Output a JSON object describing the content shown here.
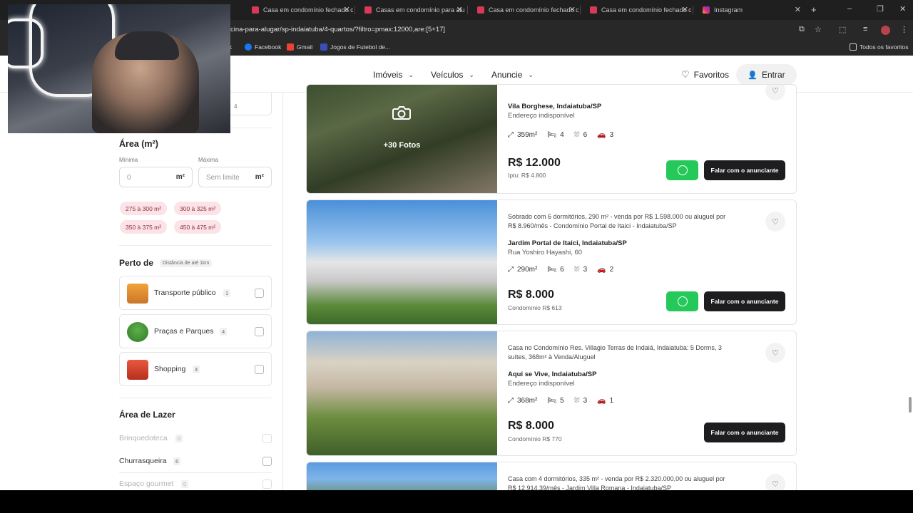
{
  "browser": {
    "tabs": [
      {
        "label": "Casa em condomínio fechado c"
      },
      {
        "label": "Casas em condomínio para alu"
      },
      {
        "label": "Casa em condomínio fechado c"
      },
      {
        "label": "Casa em condomínio fechado c"
      },
      {
        "label": "Instagram"
      }
    ],
    "url": "cina-para-alugar/sp-indaiatuba/4-quartos/?filtro=pmax:12000,are:[5+17]",
    "bookmarks": [
      {
        "label": "ok"
      },
      {
        "label": "Facebook"
      },
      {
        "label": "Gmail"
      },
      {
        "label": "Jogos de Futebol de..."
      }
    ],
    "all_bookmarks": "Todos os favoritos"
  },
  "header": {
    "nav": [
      {
        "label": "Imóveis"
      },
      {
        "label": "Veículos"
      },
      {
        "label": "Anuncie"
      }
    ],
    "favorites_label": "Favoritos",
    "login_label": "Entrar"
  },
  "sidebar": {
    "top_count": "4",
    "area": {
      "title": "Área (m²)",
      "min_label": "Mínima",
      "max_label": "Máxima",
      "min_placeholder": "0",
      "max_placeholder": "Sem limite",
      "unit": "m²",
      "chips": [
        {
          "label": "275 à 300 m²"
        },
        {
          "label": "300 à 325 m²"
        },
        {
          "label": "350 à 375 m²"
        },
        {
          "label": "450 à 475 m²"
        }
      ]
    },
    "nearby": {
      "title": "Perto de",
      "distance": "Distância de até 1km",
      "items": [
        {
          "label": "Transporte público",
          "count": "1"
        },
        {
          "label": "Praças e Parques",
          "count": "4"
        },
        {
          "label": "Shopping",
          "count": "4"
        }
      ]
    },
    "leisure": {
      "title": "Área de Lazer",
      "items": [
        {
          "label": "Brinquedoteca",
          "count": "0"
        },
        {
          "label": "Churrasqueira",
          "count": "6"
        },
        {
          "label": "Espaço gourmet",
          "count": "0"
        }
      ]
    }
  },
  "listings": [
    {
      "photos": "+30 Fotos",
      "location": "Vila Borghese, Indaiatuba/SP",
      "address": "Endereço indisponível",
      "area": "359m²",
      "bedrooms": "4",
      "bathrooms": "6",
      "parking": "3",
      "price": "R$ 12.000",
      "subprice": "Iptu: R$ 4.800",
      "cta": "Falar com o anunciante"
    },
    {
      "description": "Sobrado com 6 dormitórios, 290 m² - venda por R$ 1.598.000 ou aluguel por R$ 8.960/mês - Condomínio Portal de Itaici - Indaiatuba/SP",
      "location": "Jardim Portal de Itaici, Indaiatuba/SP",
      "address": "Rua Yoshiro Hayashi, 60",
      "area": "290m²",
      "bedrooms": "6",
      "bathrooms": "3",
      "parking": "2",
      "price": "R$ 8.000",
      "subprice": "Condomínio R$ 613",
      "cta": "Falar com o anunciante"
    },
    {
      "description": "Casa no Condomínio Res. Villagio Terras de Indaiá, Indaiatuba: 5 Dorms, 3 suítes, 368m² à Venda/Aluguel",
      "location": "Aqui se Vive, Indaiatuba/SP",
      "address": "Endereço indisponível",
      "area": "368m²",
      "bedrooms": "5",
      "bathrooms": "3",
      "parking": "1",
      "price": "R$ 8.000",
      "subprice": "Condomínio R$ 770",
      "cta": "Falar com o anunciante"
    },
    {
      "description": "Casa com 4 dormitórios, 335 m² - venda por R$ 2.320.000,00 ou aluguel por R$ 12.914,39/mês - Jardim Villa Romana - Indaiatuba/SP"
    }
  ]
}
